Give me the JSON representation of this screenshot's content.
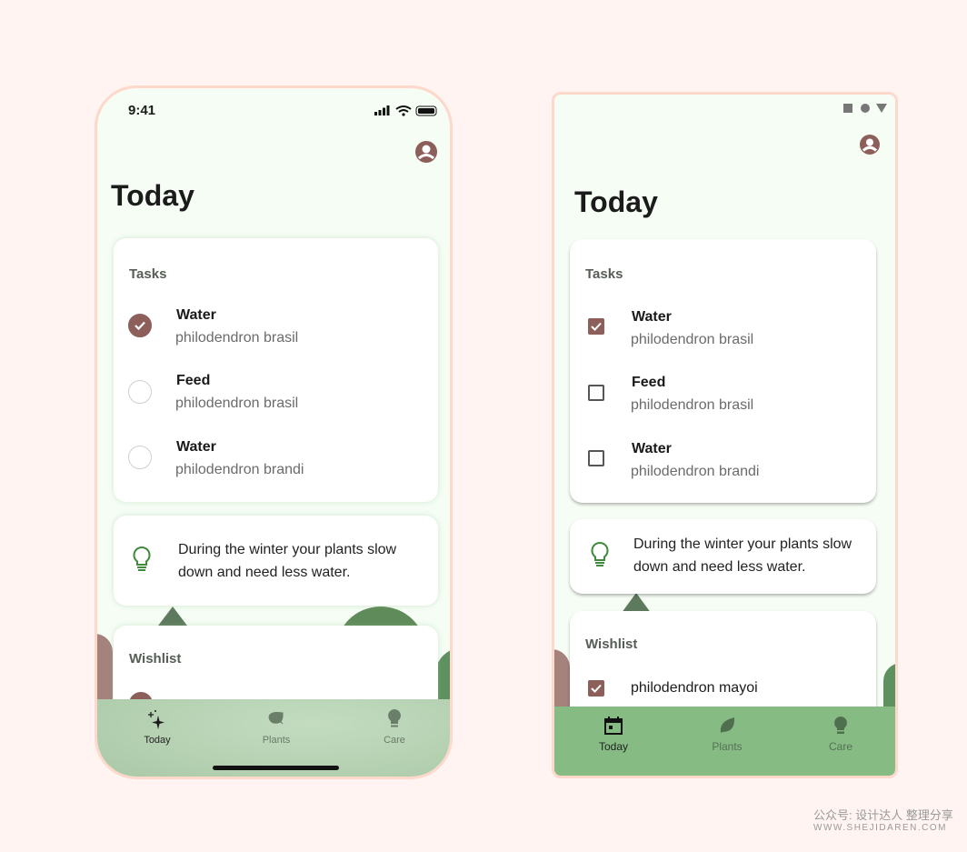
{
  "ios": {
    "status_time": "9:41",
    "title": "Today",
    "tasks": {
      "header": "Tasks",
      "items": [
        {
          "name": "Water",
          "plant": "philodendron brasil",
          "done": true
        },
        {
          "name": "Feed",
          "plant": "philodendron brasil",
          "done": false
        },
        {
          "name": "Water",
          "plant": "philodendron brandi",
          "done": false
        }
      ]
    },
    "tip": "During the winter your plants slow down and need less water.",
    "wishlist": {
      "header": "Wishlist"
    },
    "nav": [
      {
        "label": "Today",
        "icon": "sparkle-icon",
        "active": true
      },
      {
        "label": "Plants",
        "icon": "leaf-icon",
        "active": false
      },
      {
        "label": "Care",
        "icon": "lightbulb-icon",
        "active": false
      }
    ]
  },
  "android": {
    "title": "Today",
    "tasks": {
      "header": "Tasks",
      "items": [
        {
          "name": "Water",
          "plant": "philodendron brasil",
          "done": true
        },
        {
          "name": "Feed",
          "plant": "philodendron brasil",
          "done": false
        },
        {
          "name": "Water",
          "plant": "philodendron brandi",
          "done": false
        }
      ]
    },
    "tip": "During the winter your plants slow down and need less water.",
    "wishlist": {
      "header": "Wishlist",
      "items": [
        {
          "name": "philodendron mayoi",
          "done": true
        }
      ]
    },
    "nav": [
      {
        "label": "Today",
        "icon": "calendar-icon",
        "active": true
      },
      {
        "label": "Plants",
        "icon": "leaf-icon",
        "active": false
      },
      {
        "label": "Care",
        "icon": "lightbulb-icon",
        "active": false
      }
    ]
  },
  "watermark": {
    "line1": "公众号: 设计达人 整理分享",
    "line2": "WWW.SHEJIDAREN.COM"
  },
  "colors": {
    "accent": "#8d5f5b",
    "nav_android": "#86bc84",
    "nav_ios": "#b9d3b6",
    "background": "#fff4f1",
    "border": "#fdd8cb"
  }
}
